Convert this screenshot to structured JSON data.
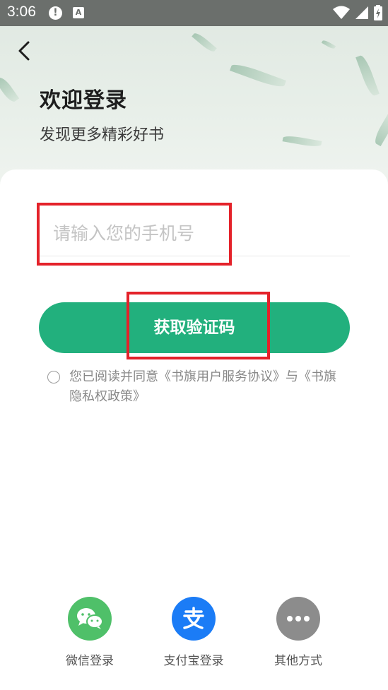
{
  "status_bar": {
    "time": "3:06",
    "alert_icon": "alert-circle-icon",
    "a_icon": "accessibility-a-icon"
  },
  "header": {
    "title": "欢迎登录",
    "subtitle": "发现更多精彩好书"
  },
  "form": {
    "phone_placeholder": "请输入您的手机号",
    "get_code_label": "获取验证码",
    "agreement_text": "您已阅读并同意《书旗用户服务协议》与《书旗隐私权政策》"
  },
  "login_options": [
    {
      "label": "微信登录",
      "icon": "wechat-icon",
      "color": "#4fc069"
    },
    {
      "label": "支付宝登录",
      "icon": "alipay-icon",
      "color": "#1b7cf6"
    },
    {
      "label": "其他方式",
      "icon": "more-icon",
      "color": "#8c8c8c"
    }
  ],
  "colors": {
    "accent": "#22b07d",
    "highlight": "#e4222a"
  }
}
